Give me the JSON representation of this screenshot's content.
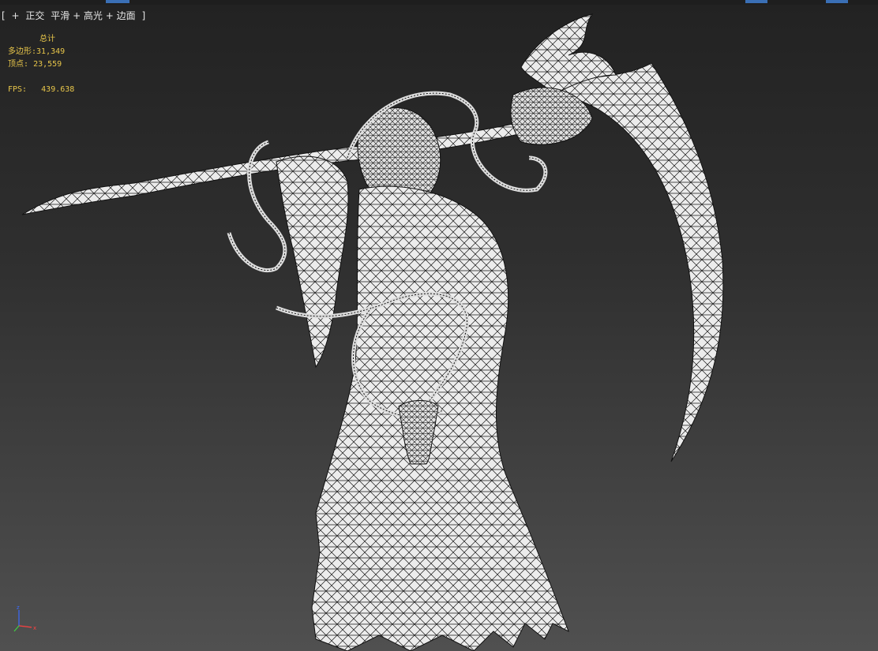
{
  "viewport": {
    "label": {
      "open": "[",
      "plus": "+",
      "view": "正交",
      "shading": "平滑 + 高光 + 边面",
      "close": "]"
    }
  },
  "stats": {
    "title": "总计",
    "polygons_label": "多边形:",
    "polygons_value": "31,349",
    "vertices_label": "顶点:",
    "vertices_value": "23,559",
    "fps_label": "FPS:",
    "fps_value": "439.638",
    "color": "#e8c64a"
  },
  "axis_gizmo": {
    "z": "z",
    "x": "x"
  },
  "colors": {
    "mesh_fill": "#ececec",
    "wire": "#151515",
    "accent": "#3a6fb5"
  }
}
